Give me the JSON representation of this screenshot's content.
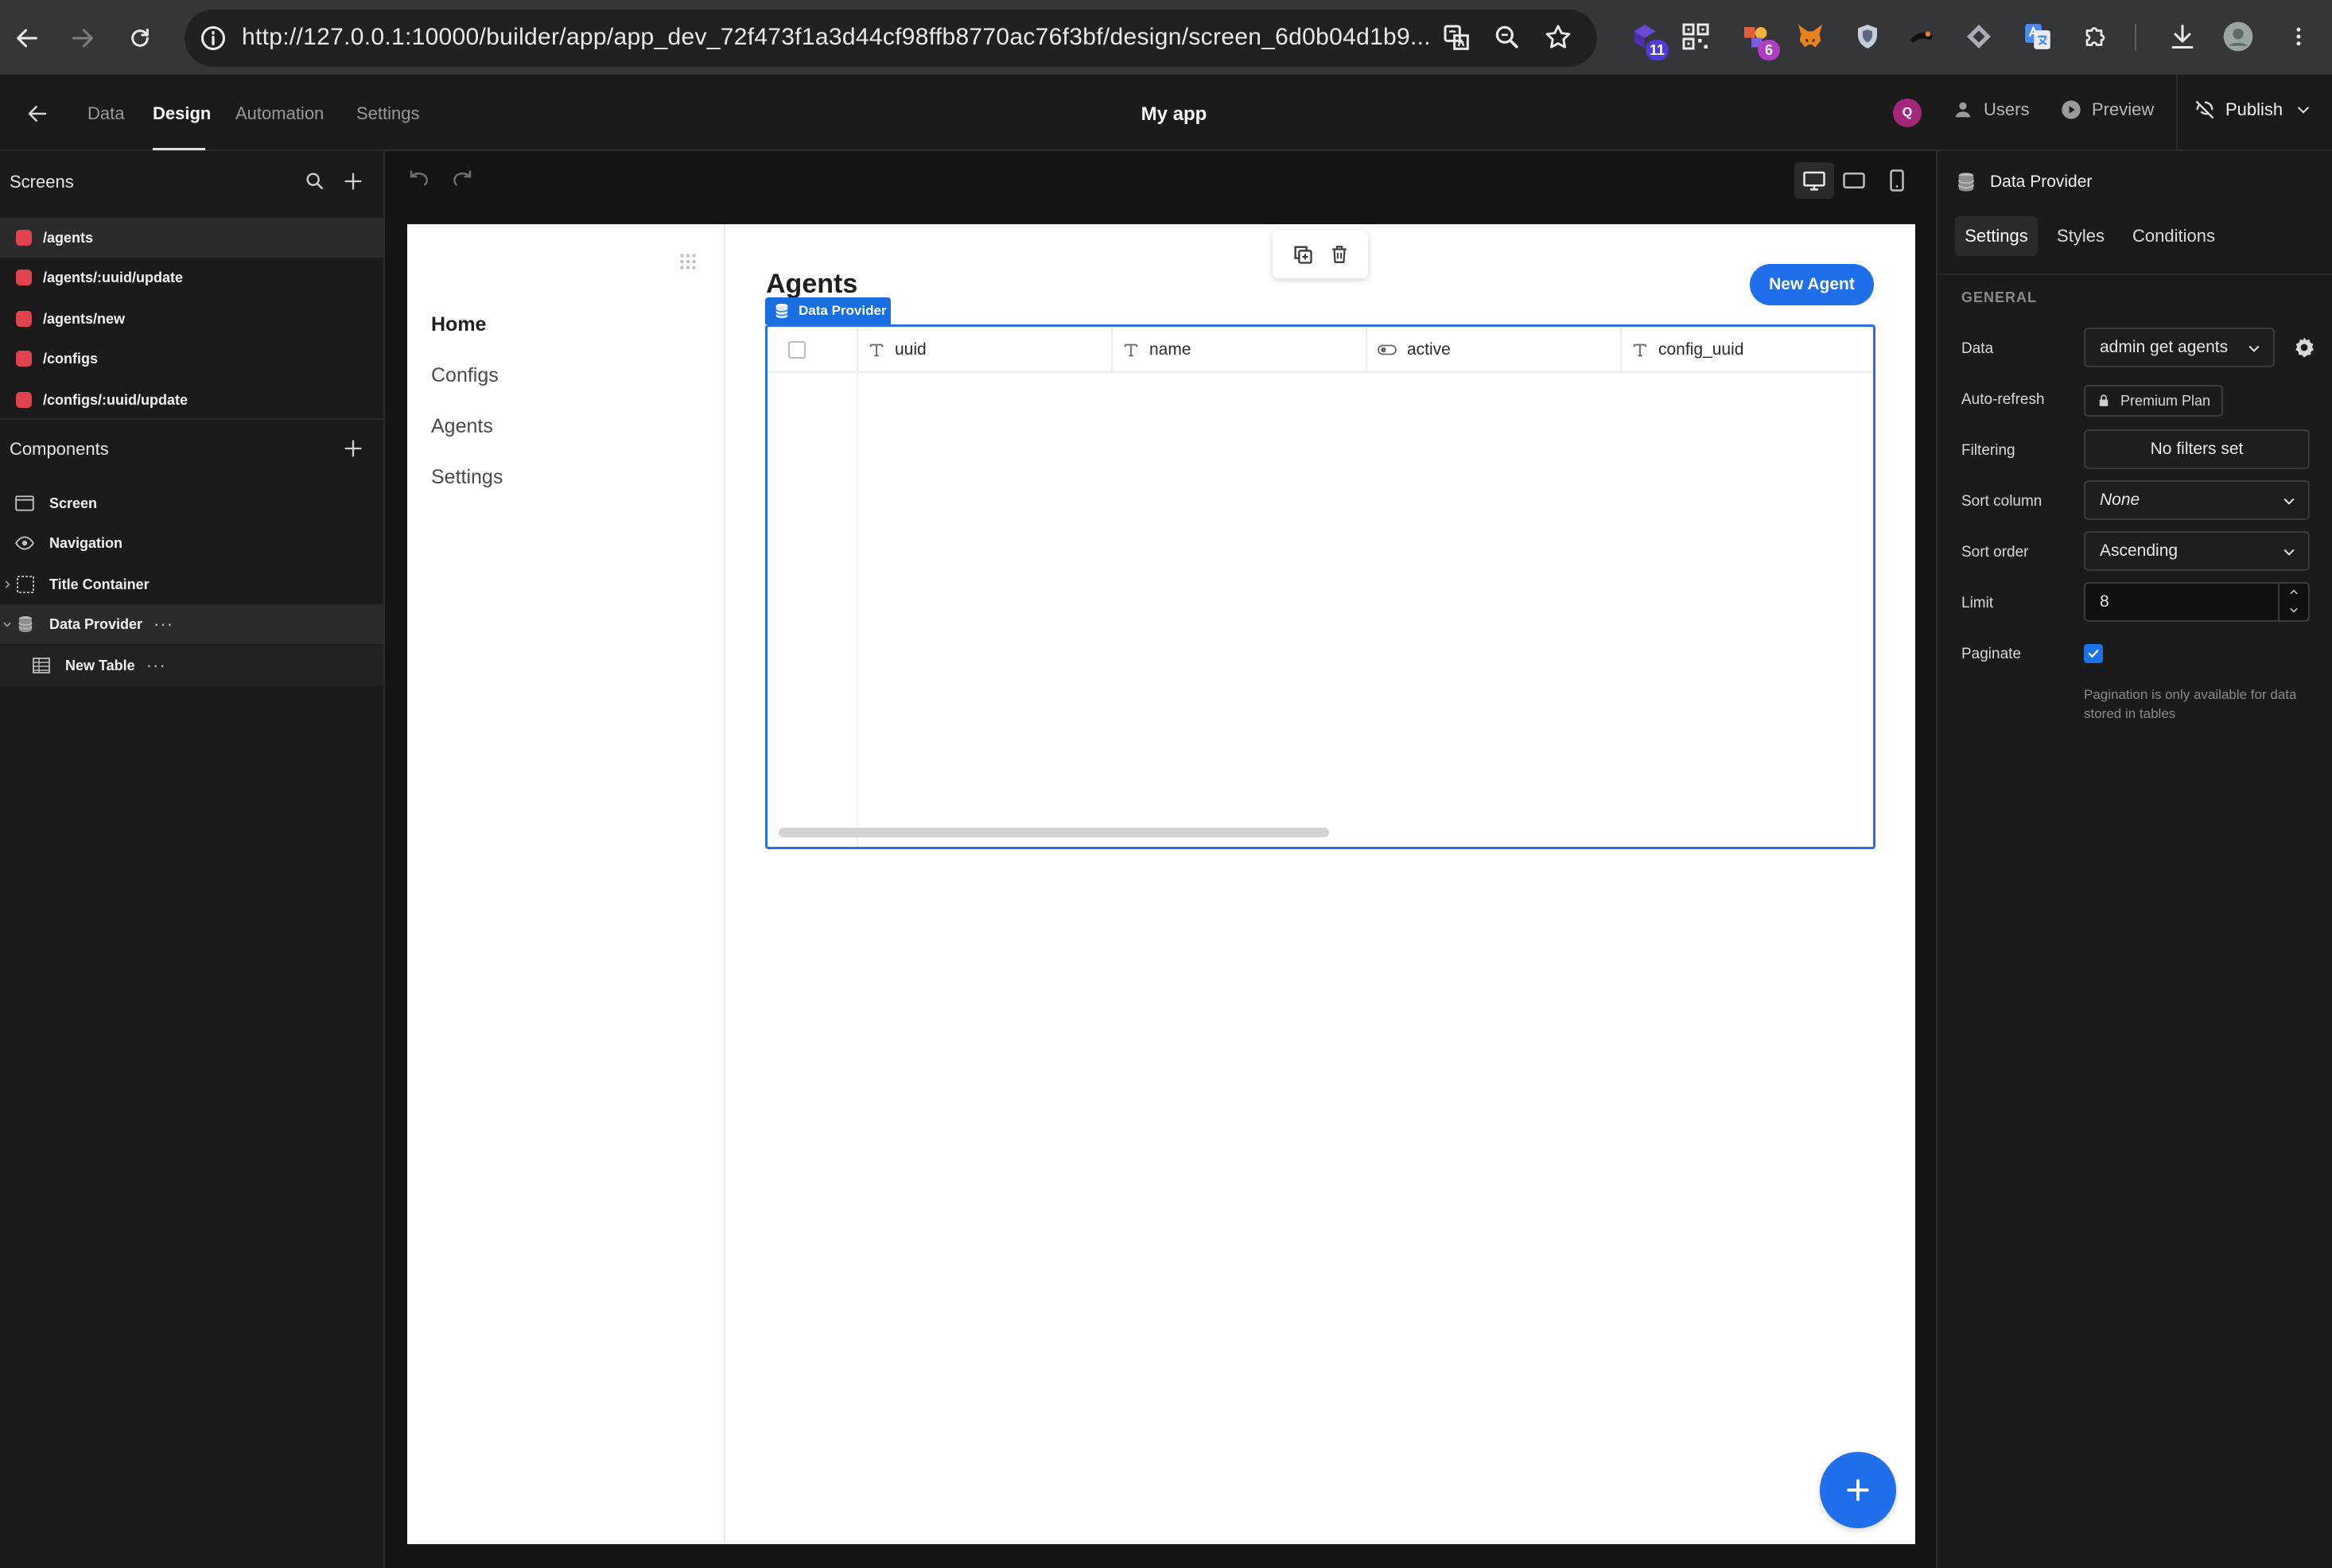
{
  "browser": {
    "url": "http://127.0.0.1:10000/builder/app/app_dev_72f473f1a3d44cf98ffb8770ac76f3bf/design/screen_6d0b04d1b9...",
    "extension_badges": [
      "11",
      "6"
    ]
  },
  "header": {
    "nav": [
      "Data",
      "Design",
      "Automation",
      "Settings"
    ],
    "active_nav": "Design",
    "app_title": "My app",
    "avatar_letter": "Q",
    "users_label": "Users",
    "preview_label": "Preview",
    "publish_label": "Publish"
  },
  "screens": {
    "title": "Screens",
    "items": [
      "/agents",
      "/agents/:uuid/update",
      "/agents/new",
      "/configs",
      "/configs/:uuid/update"
    ],
    "selected": "/agents"
  },
  "components": {
    "title": "Components",
    "items": [
      {
        "label": "Screen",
        "icon": "screen-icon"
      },
      {
        "label": "Navigation",
        "icon": "eye-icon"
      },
      {
        "label": "Title Container",
        "icon": "container-icon"
      },
      {
        "label": "Data Provider",
        "icon": "database-icon"
      },
      {
        "label": "New Table",
        "icon": "table-icon"
      }
    ],
    "more": "···"
  },
  "canvas": {
    "app_nav": [
      "Home",
      "Configs",
      "Agents",
      "Settings"
    ],
    "heading": "Agents",
    "new_agent_button": "New Agent",
    "data_provider_tag": "Data Provider",
    "table_columns": [
      {
        "name": "uuid",
        "type": "text-type-icon"
      },
      {
        "name": "name",
        "type": "text-type-icon"
      },
      {
        "name": "active",
        "type": "toggle-type-icon"
      },
      {
        "name": "config_uuid",
        "type": "text-type-icon"
      }
    ]
  },
  "settings_panel": {
    "component_title": "Data Provider",
    "tabs": [
      "Settings",
      "Styles",
      "Conditions"
    ],
    "active_tab": "Settings",
    "section": "GENERAL",
    "fields": {
      "data_label": "Data",
      "data_value": "admin get agents",
      "auto_refresh_label": "Auto-refresh",
      "auto_refresh_value": "Premium Plan",
      "filtering_label": "Filtering",
      "filtering_value": "No filters set",
      "sort_column_label": "Sort column",
      "sort_column_value": "None",
      "sort_order_label": "Sort order",
      "sort_order_value": "Ascending",
      "limit_label": "Limit",
      "limit_value": "8",
      "paginate_label": "Paginate",
      "paginate_checked": true,
      "paginate_note": "Pagination is only available for data stored in tables"
    }
  },
  "colors": {
    "accent": "#1f6feb",
    "screen_marker": "#e0424e",
    "panel_bg": "#1b1b1b"
  }
}
